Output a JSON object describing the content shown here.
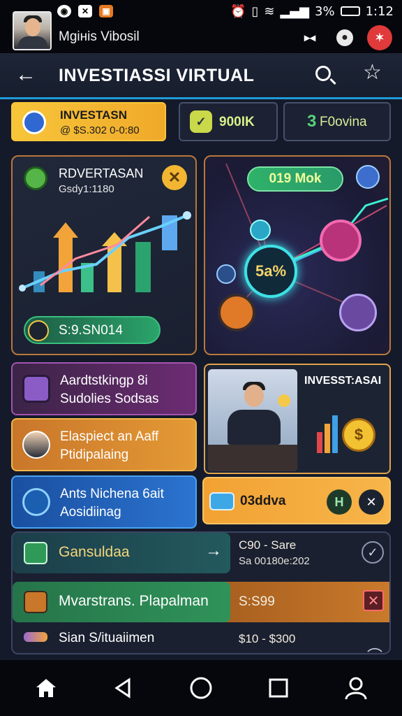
{
  "status": {
    "battery": "3%",
    "time": "1:12"
  },
  "profile": {
    "name": "Mgінis Vibosil"
  },
  "appbar": {
    "title": "INVESTIASSI VIRTUAL"
  },
  "tabs": [
    {
      "label": "INVESTASN",
      "sub": "@ $S.302 0-0:80"
    },
    {
      "label": "900IK"
    },
    {
      "label": "F0ovina",
      "icon_text": "3"
    }
  ],
  "card_a": {
    "title": "RDVERTASAN",
    "subtitle": "Gsdy1:1180",
    "pill": "S:9.SN014"
  },
  "card_b": {
    "pill": "019 Mok",
    "center": "5a%"
  },
  "rows": [
    {
      "line1": "Aardtstkingp 8i",
      "line2": "Sudolies Sodsas"
    },
    {
      "line1": "Elaspiect an Aaff",
      "line2": "Ptidipalaing"
    },
    {
      "line1": "Ants Nichena 6ait",
      "line2": "Aosidiinag"
    }
  ],
  "card_c": {
    "title": "INVESST:ASAI",
    "coin": "$"
  },
  "card_d": {
    "label": "03ddva",
    "badge": "H"
  },
  "list": [
    {
      "title": "Gansuldaa",
      "amount": "C90 - Sare",
      "date": "Sa 00180e:202"
    },
    {
      "title": "Mvarstrans. Plapalman",
      "amount": "S:S99"
    },
    {
      "title": "Sian S/ituaiimen",
      "amount": "$10 - $300"
    }
  ],
  "colors": {
    "accent": "#1e9bd8",
    "gold": "#f2b632",
    "brand_bg": "#141a2a"
  }
}
